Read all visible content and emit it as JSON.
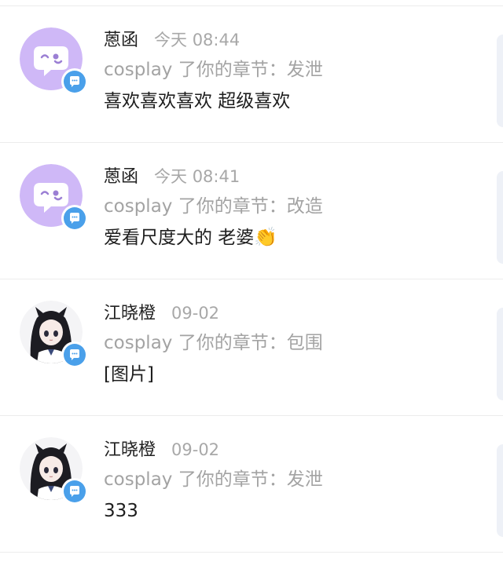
{
  "items": [
    {
      "avatar": "chat-bubble-face",
      "name": "蒽函",
      "time": "今天 08:44",
      "subtitle": "cosplay 了你的章节：发泄",
      "message": "喜欢喜欢喜欢 超级喜欢",
      "emoji": ""
    },
    {
      "avatar": "chat-bubble-face",
      "name": "蒽函",
      "time": "今天 08:41",
      "subtitle": "cosplay 了你的章节：改造",
      "message": "爱看尺度大的 老婆",
      "emoji": "👏"
    },
    {
      "avatar": "anime-girl",
      "name": "江晓橙",
      "time": "09-02",
      "subtitle": "cosplay 了你的章节：包围",
      "message": "[图片]",
      "emoji": ""
    },
    {
      "avatar": "anime-girl",
      "name": "江晓橙",
      "time": "09-02",
      "subtitle": "cosplay 了你的章节：发泄",
      "message": "333",
      "emoji": ""
    }
  ],
  "colors": {
    "badge": "#4aa0ea",
    "purple_avatar": "#cfb8f7",
    "divider": "#ececec"
  }
}
